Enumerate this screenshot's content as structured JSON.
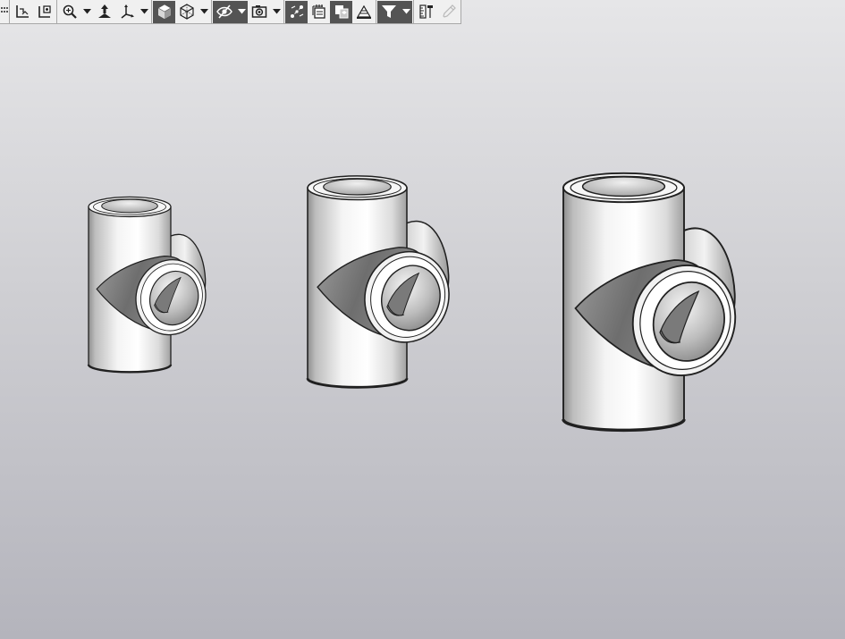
{
  "toolbar": {
    "groups": [
      {
        "items": [
          {
            "name": "local-csys-icon",
            "kind": "button",
            "active": false
          },
          {
            "name": "view-from-normal-icon",
            "kind": "button",
            "active": false
          }
        ]
      },
      {
        "items": [
          {
            "name": "zoom-icon",
            "kind": "button",
            "active": false
          },
          {
            "name": "zoom-dropdown",
            "kind": "drop",
            "active": false
          },
          {
            "name": "pan-icon",
            "kind": "button",
            "active": false
          },
          {
            "name": "orientation-icon",
            "kind": "button",
            "active": false
          },
          {
            "name": "orientation-dropdown",
            "kind": "drop",
            "active": false
          }
        ]
      },
      {
        "items": [
          {
            "name": "shaded-cube-icon",
            "kind": "button",
            "active": true
          },
          {
            "name": "wireframe-cube-icon",
            "kind": "button",
            "active": false
          },
          {
            "name": "display-mode-dropdown",
            "kind": "drop",
            "active": false
          }
        ]
      },
      {
        "items": [
          {
            "name": "hide-show-icon",
            "kind": "button",
            "active": true
          },
          {
            "name": "hide-show-dropdown",
            "kind": "drop",
            "active": true
          },
          {
            "name": "camera-icon",
            "kind": "button",
            "active": false
          },
          {
            "name": "camera-dropdown",
            "kind": "drop",
            "active": false
          }
        ]
      },
      {
        "items": [
          {
            "name": "snap-nodes-icon",
            "kind": "button",
            "active": true
          },
          {
            "name": "layers-icon",
            "kind": "button",
            "active": false
          },
          {
            "name": "copy-view-icon",
            "kind": "button",
            "active": true
          },
          {
            "name": "section-icon",
            "kind": "button",
            "active": false
          }
        ]
      },
      {
        "items": [
          {
            "name": "filter-icon",
            "kind": "button",
            "active": true
          },
          {
            "name": "filter-dropdown",
            "kind": "drop",
            "active": true
          }
        ]
      },
      {
        "items": [
          {
            "name": "measure-icon",
            "kind": "button",
            "active": false
          },
          {
            "name": "pipette-icon",
            "kind": "button",
            "active": false
          }
        ]
      }
    ]
  },
  "viewport": {
    "background_top": "#e6e6e8",
    "background_bottom": "#b4b4bc",
    "models": [
      {
        "name": "tee-fitting-small"
      },
      {
        "name": "tee-fitting-medium"
      },
      {
        "name": "tee-fitting-large"
      }
    ]
  }
}
